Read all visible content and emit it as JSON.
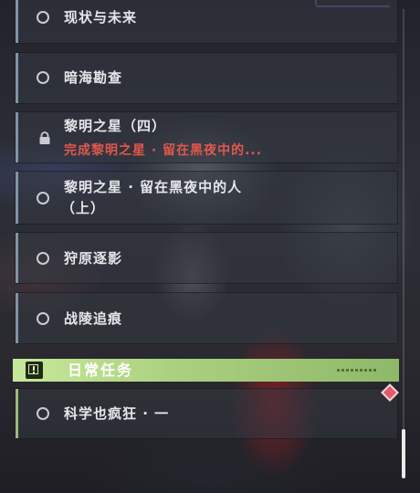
{
  "quests": [
    {
      "label": "现状与未来",
      "status": "available"
    },
    {
      "label": "暗海勘查",
      "status": "available"
    },
    {
      "label": "黎明之星（四）",
      "status": "locked",
      "requirement": "完成黎明之星 · 留在黑夜中的..."
    },
    {
      "label_line1": "黎明之星 · 留在黑夜中的人",
      "label_line2": "（上）",
      "status": "available"
    },
    {
      "label": "狩原逐影",
      "status": "available"
    },
    {
      "label": "战陵追痕",
      "status": "available"
    }
  ],
  "daily_section": {
    "title": "日常任务",
    "items": [
      {
        "label": "科学也疯狂 · 一",
        "status": "available"
      }
    ]
  },
  "colors": {
    "daily_accent": "#b9dd8e",
    "locked_requirement": "#e2574c",
    "marker": "#e35a6a"
  },
  "icons": {
    "available": "circle-icon",
    "locked": "lock-icon",
    "daily": "exclamation-box-icon",
    "new_marker": "diamond-icon"
  }
}
